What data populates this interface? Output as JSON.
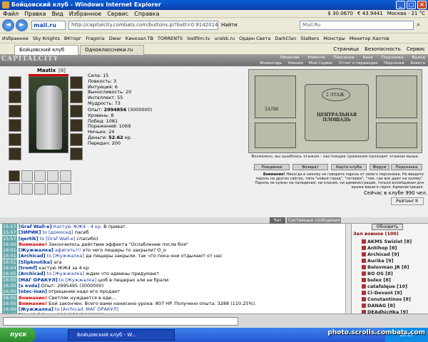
{
  "window": {
    "title": "Бойцовский клуб - Windows Internet Explorer"
  },
  "menu": [
    "Файл",
    "Правка",
    "Вид",
    "Избранное",
    "Сервис",
    "Справка"
  ],
  "tray": {
    "money": "$ 30.0670",
    "rate": "€ 43.9441",
    "weather": "Москва - 21 °C"
  },
  "address": {
    "engine": "mail.ru",
    "url": "http://capitalcity.combats.com/buttons.pl?batt=0.9142014094725",
    "find": "Найти",
    "search_placeholder": "Mail.Ru"
  },
  "favorites": [
    "Избранное",
    "Sky Knights",
    "ВКторг",
    "Fragoria",
    "Dwar",
    "Кинозал.ТВ",
    "TORRENTS",
    "lostfilm.tv",
    "uralsk.ru",
    "Орден Света",
    "DarkClan",
    "Stalkers",
    "Монстры",
    "Монитор Хаотов"
  ],
  "tabs": [
    {
      "label": "Бойцовский клуб"
    },
    {
      "label": "Одноклассники.ru"
    }
  ],
  "tab_tools": [
    "Страница",
    "Безопасность",
    "Сервис"
  ],
  "game": {
    "logo": "CAPITALCITY",
    "menu_top": [
      "Общение",
      "Новости",
      "Персонаж",
      "Банк",
      "Подсказка",
      "Выход"
    ],
    "menu_bottom": [
      "Инвентарь",
      "Умения",
      "Мой Сервис",
      "Отчет о переводах",
      "Персонаж",
      "Анкета"
    ],
    "char_name": "Mastix",
    "char_level": "[8]",
    "stats": [
      "Сила: 15",
      "Ловкость: 3",
      "Интуиция: 6",
      "Выносливость: 20",
      "Интеллект: 55",
      "Мудрость: 73"
    ],
    "experience": {
      "exp_label": "Опыт:",
      "exp_value": "2994856",
      "exp_next": "(3000000)"
    },
    "progress": [
      "Уровень: 8",
      "Побед: 1081",
      "Поражений: 1069",
      "Ничьих: 24"
    ],
    "money_label": "Деньги:",
    "money_value": "52.62",
    "money_unit": "кр.",
    "transfers": "Передач: 200",
    "map": {
      "floor": "2 ЭТАЖ",
      "hall": "ЦЕНТРАЛЬНАЯ ПЛОЩАДЬ",
      "left": "ЗАЛЫ"
    },
    "map_note": "Возможно, вы ошиблись этажом - настоящие сражения проходят этажом выше.",
    "buttons": [
      "Поединки",
      "Возврат",
      "Карта клуба",
      "Форум",
      "Подсказка"
    ],
    "warning_bold": "Внимание!",
    "warning": "Никогда и никому не говорите пароль от своего персонажа. Не вводите пароль на других сайтах, типа \"новый город\", \"лотерея\", \"там, где все дают на халяву\". Пароль не нужен ни паладинам, ни кланам, ни администрации, только взломщикам для кражи вашего героя. Администрация.",
    "online": "Сейчас в клубе 990 чел.",
    "rating": "Рейтинг®"
  },
  "chat": {
    "tab_chat": "Чат",
    "tab_system": "Системные сообщения",
    "lines": [
      {
        "time": "15:57",
        "nick": "[Graf Wall-e]",
        "to": "Кастую ЖЖ4 - 4 кр.",
        "msg": "В приват."
      },
      {
        "time": "15:57",
        "nick": "[ЗИРИК]",
        "to": "to [домосед]",
        "msg": "пасиб"
      },
      {
        "time": "15:57",
        "nick": "[qertik]",
        "to": "to [Graf Wall-e]",
        "msg": "спасибо)"
      },
      {
        "time": "16:00",
        "nick": "Внимание!",
        "to": "",
        "msg": "Закончилось действие эффекта \"Ослабление после боя\""
      },
      {
        "time": "16:01",
        "nick": "[Жужжалка]",
        "to": "афигеть!!!",
        "msg": "это чего пещеры то закрыли? О_о"
      },
      {
        "time": "16:01",
        "nick": "[Archicad]",
        "to": "to [Жужжалка]",
        "msg": "да пещеры закрыли. так что пока они отдыхают от нас"
      },
      {
        "time": "16:01",
        "nick": "[Slipknotika]",
        "to": "",
        "msg": "ага"
      },
      {
        "time": "16:04",
        "nick": "[tromf]",
        "to": "",
        "msg": "кастую ЖЖ4 за 4 кр"
      },
      {
        "time": "16:05",
        "nick": "[Archicad]",
        "to": "to [Жужжалка]",
        "msg": "ждем что админы придумают"
      },
      {
        "time": "16:05",
        "nick": "[МАГ ОРАКУЛ]",
        "to": "to [Жужжалка]",
        "msg": "шоб в пещерах эли не брали"
      },
      {
        "time": "16:05",
        "nick": "[s evda]",
        "to": "",
        "msg": "Опыт: 2995495 (3000000)"
      },
      {
        "time": "16:05",
        "nick": "[otec-ioan]",
        "to": "",
        "msg": "отрицание надо его продает"
      },
      {
        "time": "16:05",
        "nick": "Внимание!",
        "to": "",
        "msg": "Светляк нуждается в еде..."
      },
      {
        "time": "16:05",
        "nick": "Внимание!",
        "to": "",
        "msg": "Бой закончен. Всего вами нанесено урона: 807 HP. Получено опыта: 3288 (110.25%)."
      },
      {
        "time": "16:06",
        "nick": "[Жужжалка]",
        "to": "to [Archicad, МАГ ОРАКУЛ]",
        "msg": ""
      },
      {
        "time": "16:07",
        "nick": "[Mastix]",
        "to": "",
        "msg": "Опыт: 2994856 (3000000)"
      }
    ]
  },
  "side": {
    "refresh": "Обновить",
    "hall": "Зал воинов (100)",
    "users": [
      "AKMS Swizist [8]",
      "Antihop [8]",
      "Archicad [9]",
      "Aurika [9]",
      "Belovman JR [8]",
      "BO OS [8]",
      "bulex [8]",
      "catafalque [10]",
      "Ci-Devant [8]",
      "Constantinos [8]",
      "DANAG [8]",
      "DEAdhicHka [9]"
    ]
  },
  "taskbar": {
    "start": "пуск",
    "task": "Бойцовский клуб - W...",
    "clock": "16:07"
  },
  "watermark": "photo.scrolls.combats.com"
}
